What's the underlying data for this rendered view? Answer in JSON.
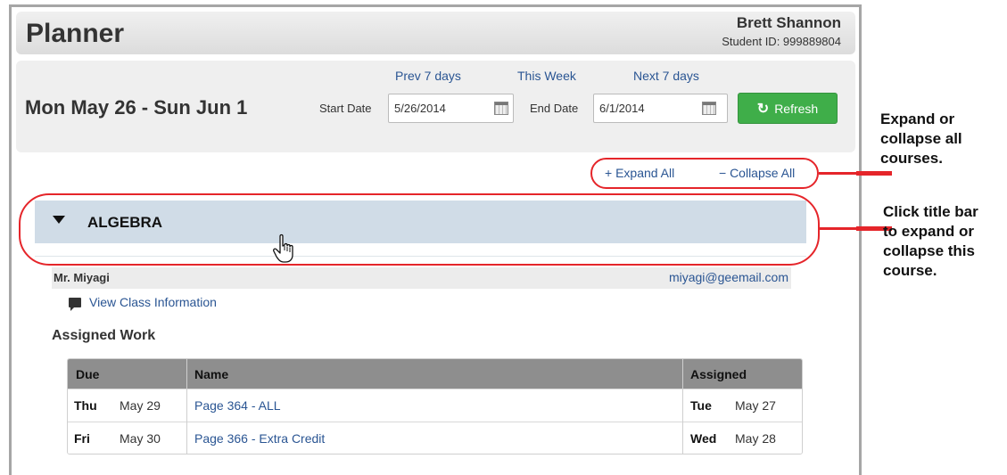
{
  "header": {
    "title": "Planner",
    "user_name": "Brett Shannon",
    "student_id": "Student ID: 999889804"
  },
  "date_bar": {
    "range": "Mon May 26 - Sun Jun 1",
    "prev_link": "Prev 7 days",
    "this_week_link": "This Week",
    "next_link": "Next 7 days",
    "start_label": "Start Date",
    "start_value": "5/26/2014",
    "end_label": "End Date",
    "end_value": "6/1/2014",
    "refresh_label": "Refresh"
  },
  "toolbar": {
    "expand_all": "+ Expand All",
    "collapse_all": "− Collapse All"
  },
  "course": {
    "title": "ALGEBRA",
    "teacher": "Mr. Miyagi",
    "email": "miyagi@geemail.com",
    "class_info_link": "View Class Information",
    "assigned_heading": "Assigned Work",
    "columns": {
      "due": "Due",
      "name": "Name",
      "assigned": "Assigned"
    },
    "rows": [
      {
        "due_day": "Thu",
        "due_date": "May 29",
        "name": "Page 364 - ALL",
        "assigned_day": "Tue",
        "assigned_date": "May 27"
      },
      {
        "due_day": "Fri",
        "due_date": "May 30",
        "name": "Page 366 - Extra Credit",
        "assigned_day": "Wed",
        "assigned_date": "May 28"
      }
    ]
  },
  "annotations": {
    "expand_collapse": [
      "Expand or",
      "collapse all",
      "courses."
    ],
    "title_bar": [
      "Click title bar",
      "to expand or",
      "collapse this",
      "course."
    ],
    "highlight_color": "#e5252a"
  }
}
